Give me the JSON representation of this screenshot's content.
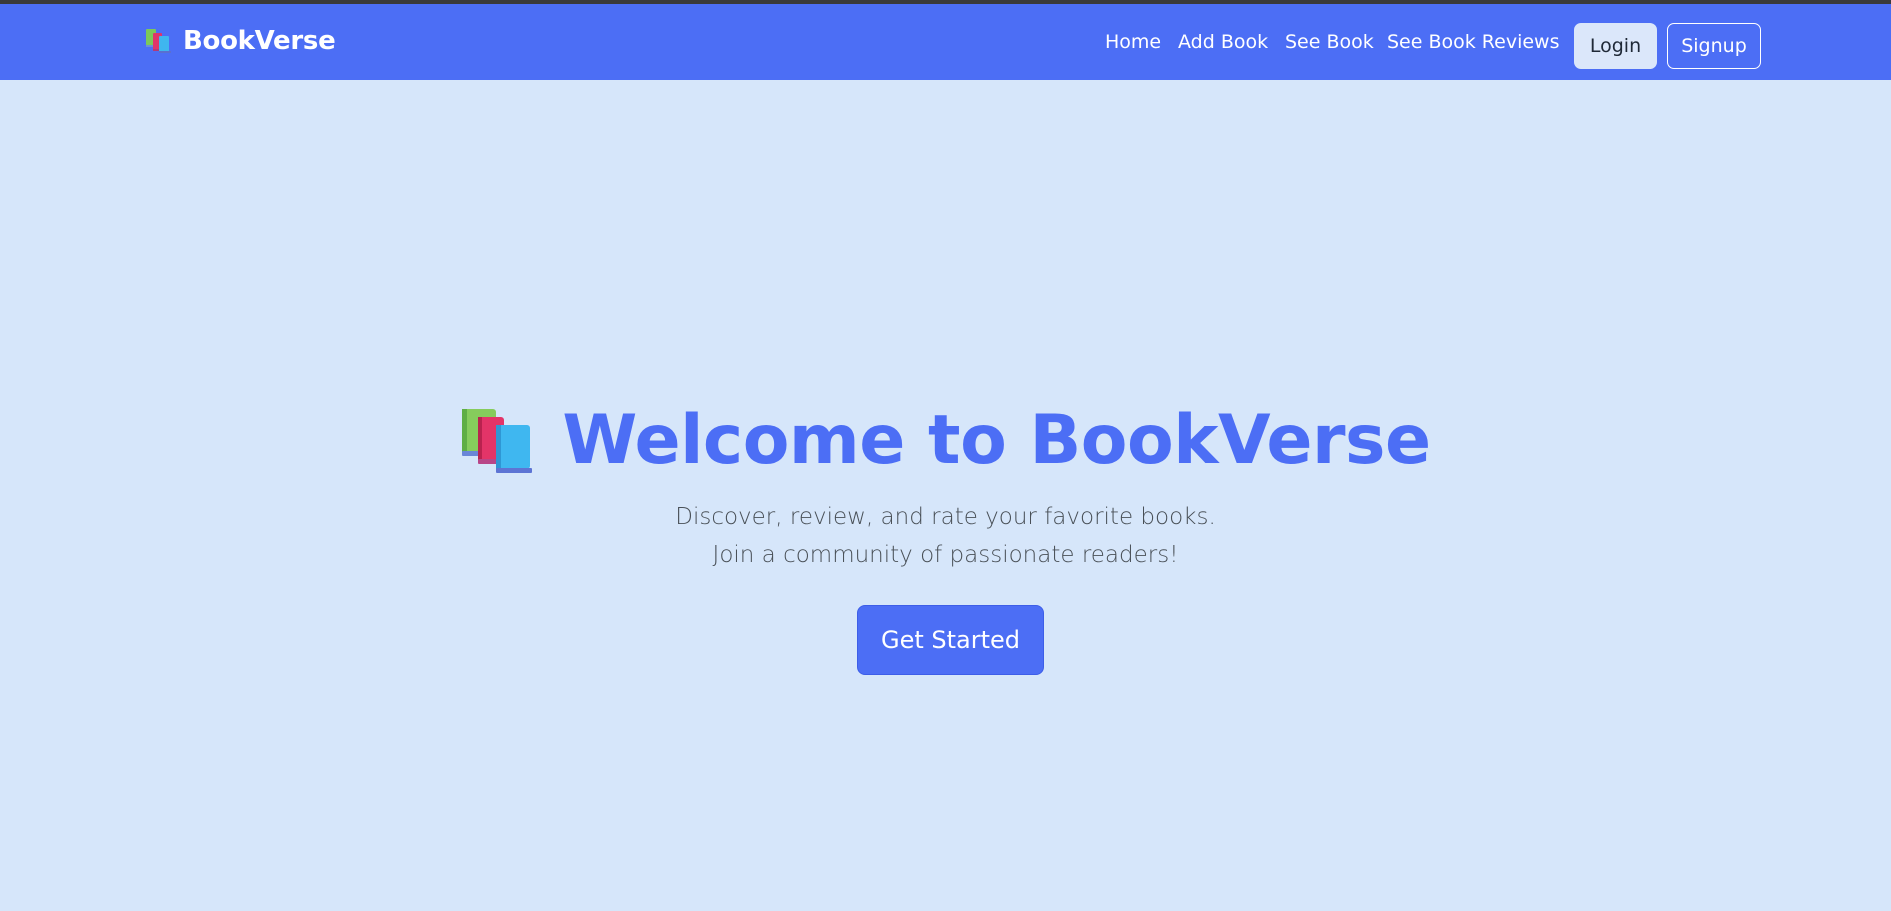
{
  "brand": {
    "name": "BookVerse",
    "icon": "books-icon"
  },
  "nav": {
    "items": [
      {
        "label": "Home"
      },
      {
        "label": "Add Book"
      },
      {
        "label": "See Book"
      },
      {
        "label": "See Book Reviews"
      }
    ],
    "login_label": "Login",
    "signup_label": "Signup"
  },
  "hero": {
    "icon": "books-icon",
    "title": "Welcome to BookVerse",
    "subtitle_line1": "Discover, review, and rate your favorite books.",
    "subtitle_line2": "Join a community of passionate readers!",
    "cta_label": "Get Started"
  },
  "colors": {
    "primary": "#4c6ef5",
    "background": "#d6e6fa",
    "login_bg": "#dbe7fa",
    "text_muted": "#495057"
  }
}
